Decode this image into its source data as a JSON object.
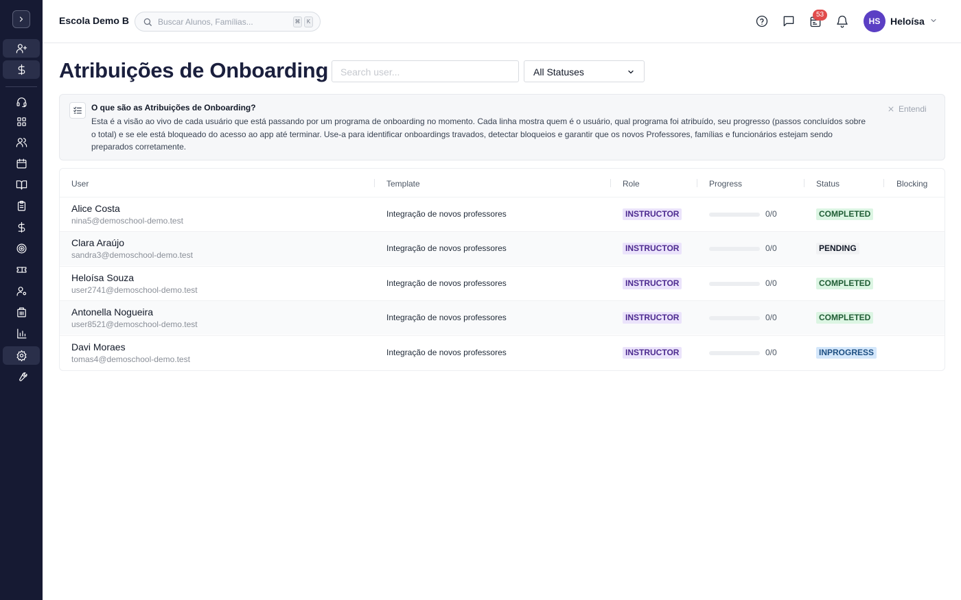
{
  "school_name": "Escola Demo B",
  "global_search": {
    "placeholder": "Buscar Alunos, Famílias...",
    "shortcut_mod": "⌘",
    "shortcut_key": "K"
  },
  "header": {
    "notification_count": "53",
    "user_initials": "HS",
    "user_name": "Heloísa"
  },
  "page": {
    "title": "Atribuições de Onboarding",
    "search_placeholder": "Search user...",
    "status_filter": "All Statuses"
  },
  "info": {
    "title": "O que são as Atribuições de Onboarding?",
    "text": "Esta é a visão ao vivo de cada usuário que está passando por um programa de onboarding no momento. Cada linha mostra quem é o usuário, qual programa foi atribuído, seu progresso (passos concluídos sobre o total) e se ele está bloqueado do acesso ao app até terminar. Use-a para identificar onboardings travados, detectar bloqueios e garantir que os novos Professores, famílias e funcionários estejam sendo preparados corretamente.",
    "dismiss": "Entendi"
  },
  "table": {
    "columns": [
      "User",
      "Template",
      "Role",
      "Progress",
      "Status",
      "Blocking"
    ],
    "rows": [
      {
        "name": "Alice Costa",
        "email": "nina5@demoschool-demo.test",
        "template": "Integração de novos professores",
        "role": "INSTRUCTOR",
        "progress": "0/0",
        "progress_fraction": 0,
        "status": "COMPLETED",
        "status_kind": "completed"
      },
      {
        "name": "Clara Araújo",
        "email": "sandra3@demoschool-demo.test",
        "template": "Integração de novos professores",
        "role": "INSTRUCTOR",
        "progress": "0/0",
        "progress_fraction": 0,
        "status": "PENDING",
        "status_kind": "pending"
      },
      {
        "name": "Heloísa Souza",
        "email": "user2741@demoschool-demo.test",
        "template": "Integração de novos professores",
        "role": "INSTRUCTOR",
        "progress": "0/0",
        "progress_fraction": 0,
        "status": "COMPLETED",
        "status_kind": "completed"
      },
      {
        "name": "Antonella Nogueira",
        "email": "user8521@demoschool-demo.test",
        "template": "Integração de novos professores",
        "role": "INSTRUCTOR",
        "progress": "0/0",
        "progress_fraction": 0,
        "status": "COMPLETED",
        "status_kind": "completed"
      },
      {
        "name": "Davi Moraes",
        "email": "tomas4@demoschool-demo.test",
        "template": "Integração de novos professores",
        "role": "INSTRUCTOR",
        "progress": "0/0",
        "progress_fraction": 0,
        "status": "INPROGRESS",
        "status_kind": "inprogress"
      }
    ]
  },
  "sidebar": {
    "icons": [
      "user-plus-icon",
      "dollar-icon",
      "headset-icon",
      "dashboard-icon",
      "users-icon",
      "calendar-icon",
      "book-icon",
      "clipboard-icon",
      "dollar-icon",
      "target-icon",
      "ticket-icon",
      "user-cog-icon",
      "building-icon",
      "bar-chart-icon",
      "gear-icon",
      "wrench-icon"
    ]
  },
  "colors": {
    "sidebar_bg": "#161a33",
    "title": "#1a1f3d",
    "avatar": "#5b3fc4",
    "badge": "#e14c4c",
    "role_bg": "#ebe3fb",
    "completed_bg": "#dcf5e3",
    "inprogress_bg": "#d4e7fb"
  }
}
